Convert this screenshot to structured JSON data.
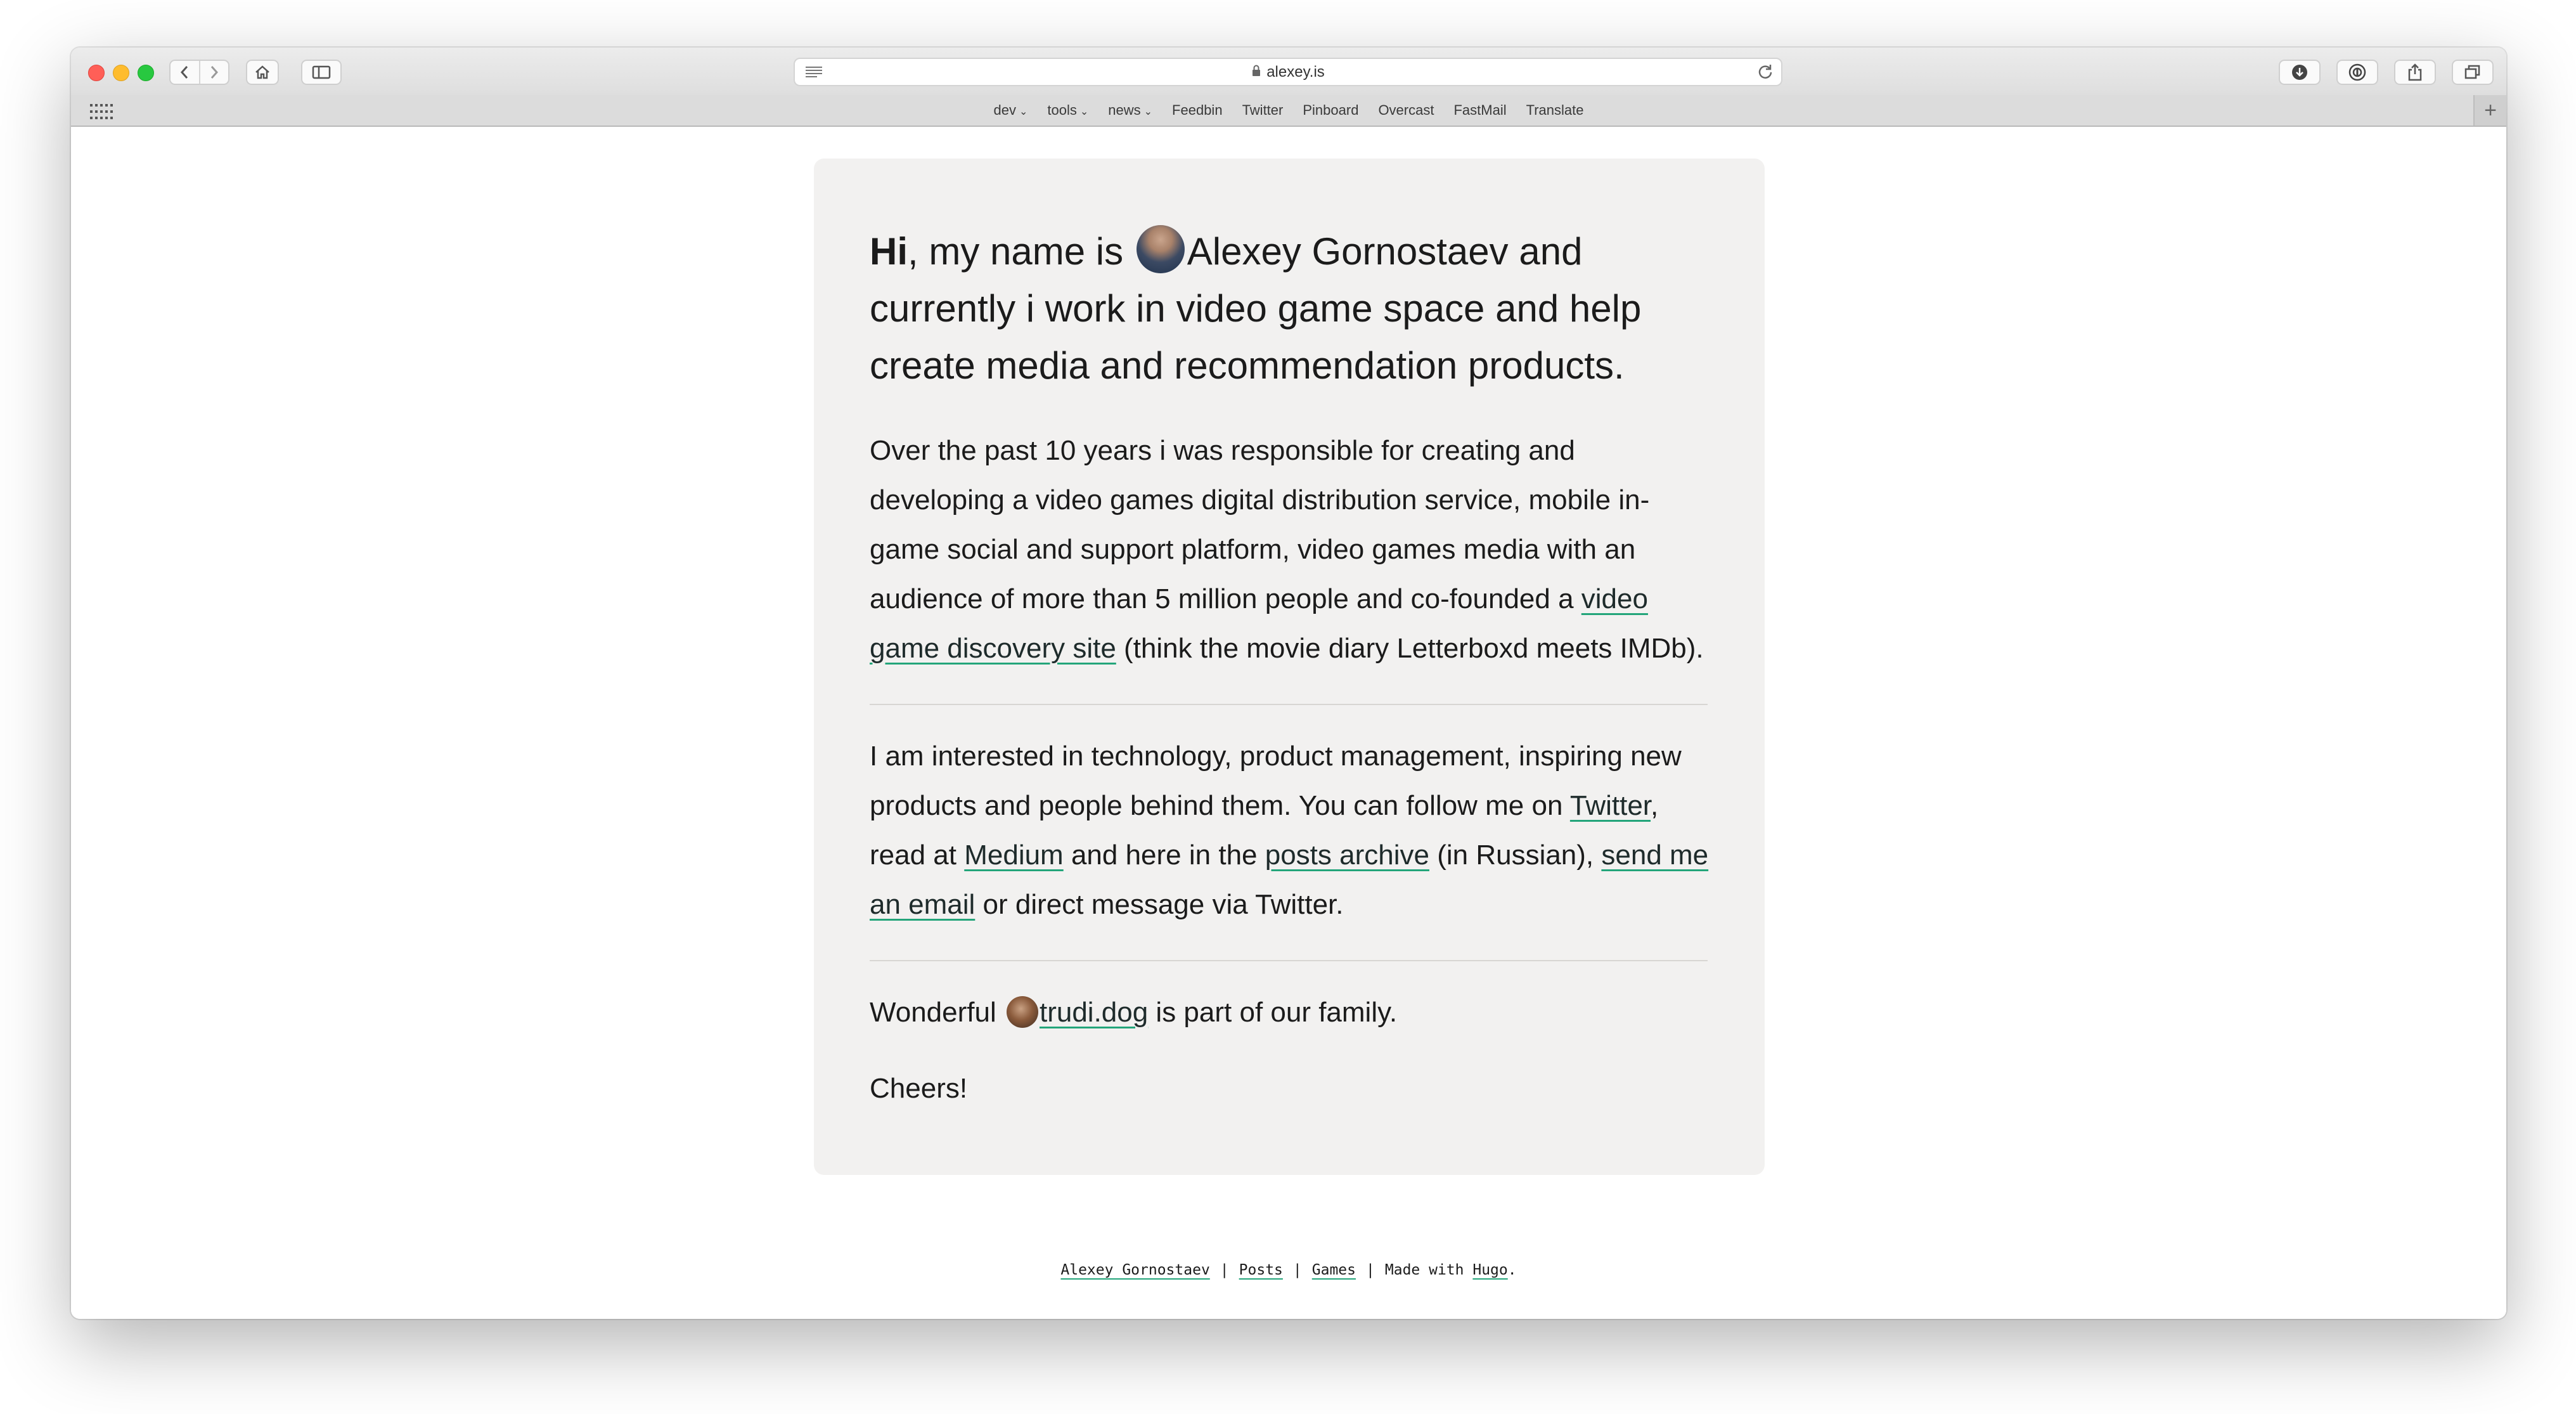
{
  "browser": {
    "address": "alexey.is",
    "favorites": [
      {
        "label": "dev",
        "menu": true
      },
      {
        "label": "tools",
        "menu": true
      },
      {
        "label": "news",
        "menu": true
      },
      {
        "label": "Feedbin",
        "menu": false
      },
      {
        "label": "Twitter",
        "menu": false
      },
      {
        "label": "Pinboard",
        "menu": false
      },
      {
        "label": "Overcast",
        "menu": false
      },
      {
        "label": "FastMail",
        "menu": false
      },
      {
        "label": "Translate",
        "menu": false
      }
    ],
    "icons": {
      "back": "chevron-left-icon",
      "forward": "chevron-right-icon",
      "home": "home-icon",
      "sidebar": "sidebar-icon",
      "reader": "reader-icon",
      "lock": "lock-icon",
      "reload": "reload-icon",
      "download": "download-icon",
      "password": "password-icon",
      "share": "share-icon",
      "tabs": "tabs-icon",
      "add": "plus-icon"
    }
  },
  "page": {
    "intro": {
      "greeting": "Hi",
      "before_name": ", my name is ",
      "name_and_rest": "Alexey Gornostaev and currently i work in video game space and help create media and recommendation products."
    },
    "p1": {
      "before_link": "Over the past 10 years i was responsible for creating and developing a video games digital distribution service, mobile in-game social and support platform, video games media with an audience of more than 5 million people and co-founded a ",
      "link": "video game discovery site",
      "after_link": " (think the movie diary Letterboxd meets IMDb)."
    },
    "p2": {
      "t1": "I am interested in technology, product management, inspiring new products and people behind them. You can follow me on ",
      "twitter": "Twitter",
      "t2": ", read at ",
      "medium": "Medium",
      "t3": " and here in the ",
      "posts_archive": "posts archive",
      "t4": " (in Russian), ",
      "email": "send me an email",
      "t5": " or direct message via Twitter."
    },
    "p3": {
      "t1": "Wonderful ",
      "dog_link": "trudi.dog",
      "t2": " is part of our family."
    },
    "cheers": "Cheers!"
  },
  "footer": {
    "author": "Alexey Gornostaev",
    "sep": "|",
    "posts": "Posts",
    "games": "Games",
    "made_with": "Made with",
    "hugo": "Hugo",
    "period": "."
  },
  "colors": {
    "card_bg": "#f2f1f0",
    "link_underline": "#23a57a",
    "text": "#1b1b1b"
  }
}
